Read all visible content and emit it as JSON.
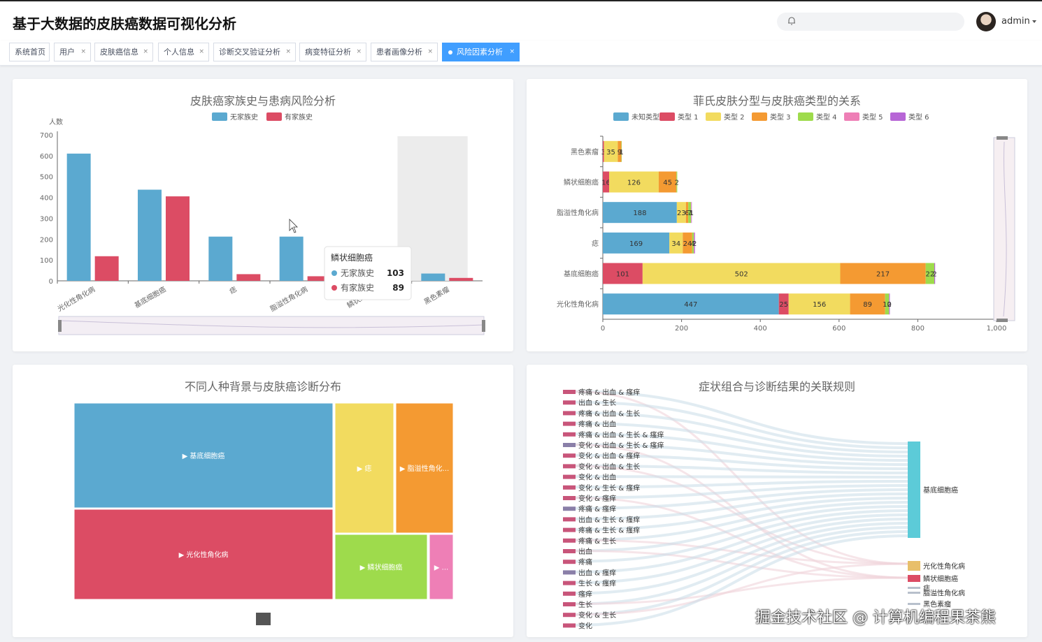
{
  "header": {
    "title": "基于大数据的皮肤癌数据可视化分析",
    "user": "admin"
  },
  "tabs": [
    {
      "label": "系统首页",
      "closable": false
    },
    {
      "label": "用户",
      "closable": true
    },
    {
      "label": "皮肤癌信息",
      "closable": true
    },
    {
      "label": "个人信息",
      "closable": true
    },
    {
      "label": "诊断交叉验证分析",
      "closable": true
    },
    {
      "label": "病变特征分析",
      "closable": true
    },
    {
      "label": "患者画像分析",
      "closable": true
    },
    {
      "label": "风险因素分析",
      "closable": true,
      "active": true
    }
  ],
  "close_symbol": "×",
  "colors": {
    "blue": "#5ba9d0",
    "red": "#dc4c64",
    "yellow": "#f2db5f",
    "orange": "#f49a32",
    "green": "#9edb4c",
    "pink": "#ee7fb6",
    "purple": "#b766d6",
    "accent": "#409eff"
  },
  "panels": {
    "family": {
      "title": "皮肤癌家族史与患病风险分析",
      "ylabel": "人数"
    },
    "fitz": {
      "title": "菲氏皮肤分型与皮肤癌类型的关系"
    },
    "race": {
      "title": "不同人种背景与皮肤癌诊断分布"
    },
    "assoc": {
      "title": "症状组合与诊断结果的关联规则"
    }
  },
  "chart_data": [
    {
      "type": "bar",
      "title": "皮肤癌家族史与患病风险分析",
      "ylabel": "人数",
      "ylim": [
        0,
        700
      ],
      "yticks": [
        0,
        100,
        200,
        300,
        400,
        500,
        600,
        700
      ],
      "categories": [
        "光化性角化病",
        "基底细胞癌",
        "痣",
        "脂溢性角化病",
        "鳞状细胞癌",
        "黑色素瘤"
      ],
      "series": [
        {
          "name": "无家族史",
          "color": "#5ba9d0",
          "values": [
            610,
            437,
            212,
            212,
            103,
            35
          ]
        },
        {
          "name": "有家族史",
          "color": "#dc4c64",
          "values": [
            118,
            405,
            32,
            22,
            89,
            14
          ]
        }
      ],
      "tooltip": {
        "category": "鳞状细胞癌",
        "rows": [
          {
            "name": "无家族史",
            "value": "103"
          },
          {
            "name": "有家族史",
            "value": "89"
          }
        ]
      },
      "legend": "top"
    },
    {
      "type": "bar",
      "orientation": "horizontal",
      "stacked": true,
      "title": "菲氏皮肤分型与皮肤癌类型的关系",
      "xlim": [
        0,
        1000
      ],
      "xticks": [
        "0",
        "200",
        "400",
        "600",
        "800",
        "1,000"
      ],
      "categories": [
        "黑色素瘤",
        "鳞状细胞癌",
        "脂溢性角化病",
        "痣",
        "基底细胞癌",
        "光化性角化病"
      ],
      "series": [
        {
          "name": "未知类型",
          "color": "#5ba9d0",
          "values": [
            0,
            0,
            188,
            169,
            0,
            447
          ]
        },
        {
          "name": "类型 1",
          "color": "#dc4c64",
          "values": [
            3,
            16,
            0,
            0,
            101,
            25
          ]
        },
        {
          "name": "类型 2",
          "color": "#f2db5f",
          "values": [
            35,
            126,
            23,
            34,
            502,
            156
          ]
        },
        {
          "name": "类型 3",
          "color": "#f49a32",
          "values": [
            9,
            45,
            6,
            24,
            217,
            89
          ]
        },
        {
          "name": "类型 4",
          "color": "#9edb4c",
          "values": [
            1,
            2,
            7,
            4,
            22,
            10
          ]
        },
        {
          "name": "类型 5",
          "color": "#ee7fb6",
          "values": [
            0,
            0,
            1,
            1,
            0,
            0
          ]
        },
        {
          "name": "类型 6",
          "color": "#b766d6",
          "values": [
            0,
            0,
            1,
            2,
            2,
            2
          ]
        }
      ],
      "legend": "top"
    },
    {
      "type": "treemap",
      "title": "不同人种背景与皮肤癌诊断分布",
      "nodes": [
        {
          "name": "▶ 基底细胞癌",
          "color": "#5ba9d0",
          "value": 847
        },
        {
          "name": "▶ 光化性角化病",
          "color": "#dc4c64",
          "value": 732
        },
        {
          "name": "▶ 痣",
          "color": "#f2db5f",
          "value": 233
        },
        {
          "name": "▶ 脂溢性角化...",
          "color": "#f49a32",
          "value": 235
        },
        {
          "name": "▶ 鳞状细胞癌",
          "color": "#9edb4c",
          "value": 192
        },
        {
          "name": "▶ ...",
          "color": "#ee7fb6",
          "value": 49
        }
      ]
    },
    {
      "type": "sankey",
      "title": "症状组合与诊断结果的关联规则",
      "sources": [
        "疼痛 & 出血 & 瘙痒",
        "出血 & 生长",
        "疼痛 & 出血 & 生长",
        "疼痛 & 出血",
        "疼痛 & 出血 & 生长 & 瘙痒",
        "变化 & 出血 & 生长 & 瘙痒",
        "变化 & 出血 & 瘙痒",
        "变化 & 出血 & 生长",
        "变化 & 出血",
        "变化 & 生长 & 瘙痒",
        "变化 & 瘙痒",
        "疼痛 & 瘙痒",
        "出血 & 生长 & 瘙痒",
        "疼痛 & 生长 & 瘙痒",
        "疼痛 & 生长",
        "出血",
        "疼痛",
        "出血 & 瘙痒",
        "生长 & 瘙痒",
        "瘙痒",
        "生长",
        "变化 & 生长",
        "变化"
      ],
      "targets": [
        {
          "name": "基底细胞癌",
          "color": "#5ccbd8"
        },
        {
          "name": "光化性角化病",
          "color": "#e8bf6a"
        },
        {
          "name": "鳞状细胞癌",
          "color": "#dc4c64"
        },
        {
          "name": "痣",
          "color": "#b8c0cc"
        },
        {
          "name": "脂溢性角化病",
          "color": "#b8c0cc"
        },
        {
          "name": "黑色素瘤",
          "color": "#b8c0cc"
        }
      ]
    }
  ],
  "watermark": "掘金技术社区 @ 计算机编程果茶熊"
}
